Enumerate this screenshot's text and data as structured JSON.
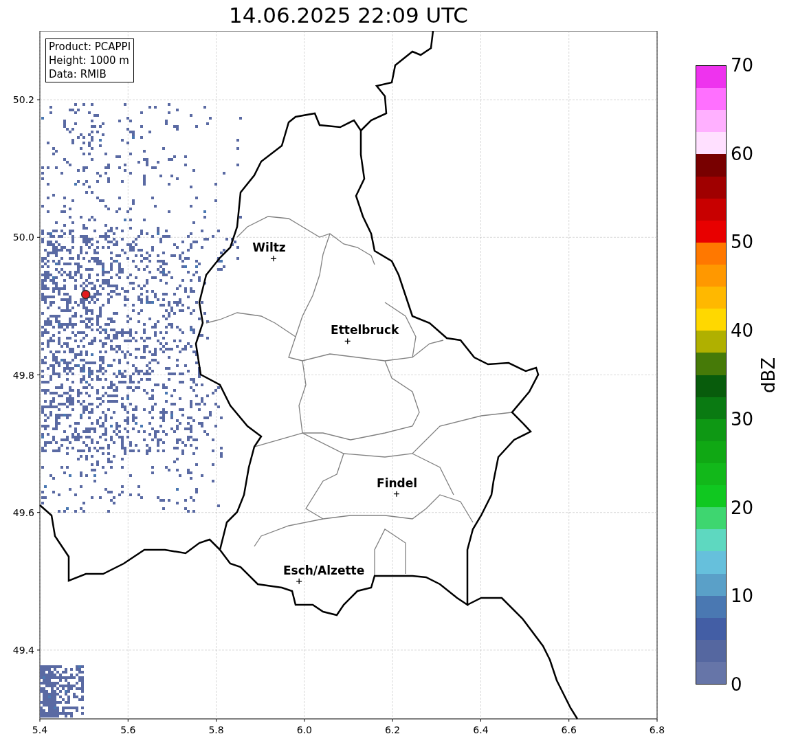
{
  "title": "14.06.2025 22:09 UTC",
  "map": {
    "x_tick_labels": [
      "5.4",
      "5.6",
      "5.8",
      "6.0",
      "6.2",
      "6.4",
      "6.6",
      "6.8"
    ],
    "y_tick_labels": [
      "50.2",
      "50.0",
      "49.8",
      "49.6",
      "49.4"
    ],
    "cities": [
      {
        "name": "Wiltz"
      },
      {
        "name": "Ettelbruck"
      },
      {
        "name": "Findel"
      },
      {
        "name": "Esch/Alzette"
      }
    ]
  },
  "info_box": {
    "lines": [
      "Product: PCAPPI",
      "Height: 1000 m",
      "Data: RMIB"
    ]
  },
  "colorbar": {
    "label": "dBZ",
    "ticks": [
      "70",
      "60",
      "50",
      "40",
      "30",
      "20",
      "10",
      "0"
    ],
    "bins": [
      {
        "color": "#ee33ee"
      },
      {
        "color": "#ff70ff"
      },
      {
        "color": "#ffb0ff"
      },
      {
        "color": "#ffe0ff"
      },
      {
        "color": "#780000"
      },
      {
        "color": "#a00000"
      },
      {
        "color": "#c80000"
      },
      {
        "color": "#e80000"
      },
      {
        "color": "#ff7800"
      },
      {
        "color": "#ff9800"
      },
      {
        "color": "#ffb800"
      },
      {
        "color": "#ffd800"
      },
      {
        "color": "#b0b000"
      },
      {
        "color": "#467a08"
      },
      {
        "color": "#085c0c"
      },
      {
        "color": "#0a7a12"
      },
      {
        "color": "#0e9814"
      },
      {
        "color": "#10a814"
      },
      {
        "color": "#12b81a"
      },
      {
        "color": "#10c820"
      },
      {
        "color": "#3ed670"
      },
      {
        "color": "#5ed8c0"
      },
      {
        "color": "#66c0dc"
      },
      {
        "color": "#5aa0c8"
      },
      {
        "color": "#4a78b2"
      },
      {
        "color": "#435ea5"
      },
      {
        "color": "#5567a0"
      },
      {
        "color": "#6675a8"
      }
    ]
  }
}
